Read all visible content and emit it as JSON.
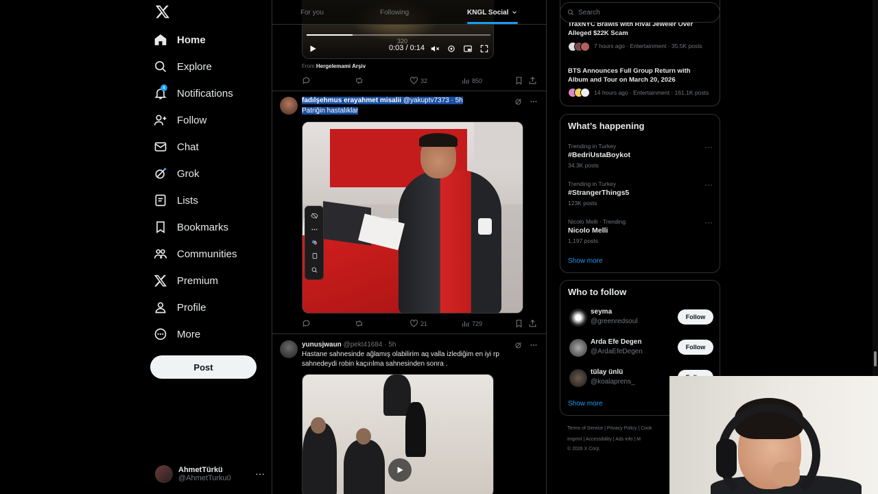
{
  "sidebar": {
    "items": [
      {
        "label": "Home",
        "icon": "home-icon"
      },
      {
        "label": "Explore",
        "icon": "search-icon"
      },
      {
        "label": "Notifications",
        "icon": "bell-icon",
        "badge": "4"
      },
      {
        "label": "Follow",
        "icon": "person-add-icon"
      },
      {
        "label": "Chat",
        "icon": "mail-icon"
      },
      {
        "label": "Grok",
        "icon": "grok-icon"
      },
      {
        "label": "Lists",
        "icon": "list-icon"
      },
      {
        "label": "Bookmarks",
        "icon": "bookmark-icon"
      },
      {
        "label": "Communities",
        "icon": "communities-icon"
      },
      {
        "label": "Premium",
        "icon": "x-logo-icon"
      },
      {
        "label": "Profile",
        "icon": "person-icon"
      },
      {
        "label": "More",
        "icon": "more-circle-icon"
      }
    ],
    "post_label": "Post",
    "account": {
      "name": "AhmetTürkü",
      "handle": "@AhmetTurku0",
      "more": "···"
    }
  },
  "timeline": {
    "tabs": [
      {
        "label": "For you"
      },
      {
        "label": "Following"
      },
      {
        "label": "KNGL Social"
      }
    ],
    "tweet1": {
      "video_time": "0:03 / 0:14",
      "video_overlay_num": "320",
      "progress": 0.25,
      "from_prefix": "From",
      "from_name": "Hergelemami Arşiv",
      "replies": "",
      "retweets": "",
      "likes": "32",
      "views": "850"
    },
    "tweet2": {
      "name": "fadılşehmus erayahmet misalii",
      "handle": "@yakuptv7373",
      "time": "· 5h",
      "text": "Patriğin hastalıklar",
      "likes": "21",
      "views": "729"
    },
    "tweet3": {
      "name": "yunusjwaun",
      "handle": "@pekt41684",
      "time": "· 5h",
      "text": "Hastane sahnesinde ağlamış olabilirim aq valla izlediğim en iyi rp sahnedeydi robin kaçırılma sahnesinden sonra ."
    }
  },
  "right": {
    "search_placeholder": "Search",
    "news": [
      {
        "title": "TraxNYC Brawls with Rival Jeweler Over Alleged $22K Scam",
        "meta": "7 hours ago · Entertainment · 35.5K posts"
      },
      {
        "title": "BTS Announces Full Group Return with Album and Tour on March 20, 2026",
        "meta": "14 hours ago · Entertainment · 161.1K posts"
      }
    ],
    "happening_title": "What’s happening",
    "trends": [
      {
        "category": "Trending in Turkey",
        "name": "#BedriUstaBoykot",
        "count": "34.3K posts"
      },
      {
        "category": "Trending in Turkey",
        "name": "#StrangerThings5",
        "count": "123K posts"
      },
      {
        "category": "Nicolo Melli · Trending",
        "name": "Nicolo Melli",
        "count": "1,197 posts"
      }
    ],
    "trend_more": "···",
    "show_more": "Show more",
    "who_title": "Who to follow",
    "who": [
      {
        "name": "seyma",
        "handle": "@greenredsoul",
        "button": "Follow"
      },
      {
        "name": "Arda Efe Degen",
        "handle": "@ArdaEfeDegen",
        "button": "Follow"
      },
      {
        "name": "tülay ünlü",
        "handle": "@koalaprens_",
        "button": "Follow"
      }
    ],
    "footer_line1": "Terms of Service  |  Privacy Policy  |  Cook",
    "footer_line2": "Imprint  |  Accessibility  |  Ads info  |  M",
    "footer_line3": "© 2026 X Corp."
  },
  "colors": {
    "accent": "#1d9bf0",
    "bg": "#000000",
    "text": "#e7e9ea",
    "muted": "#71767b",
    "border": "#2f3336"
  }
}
